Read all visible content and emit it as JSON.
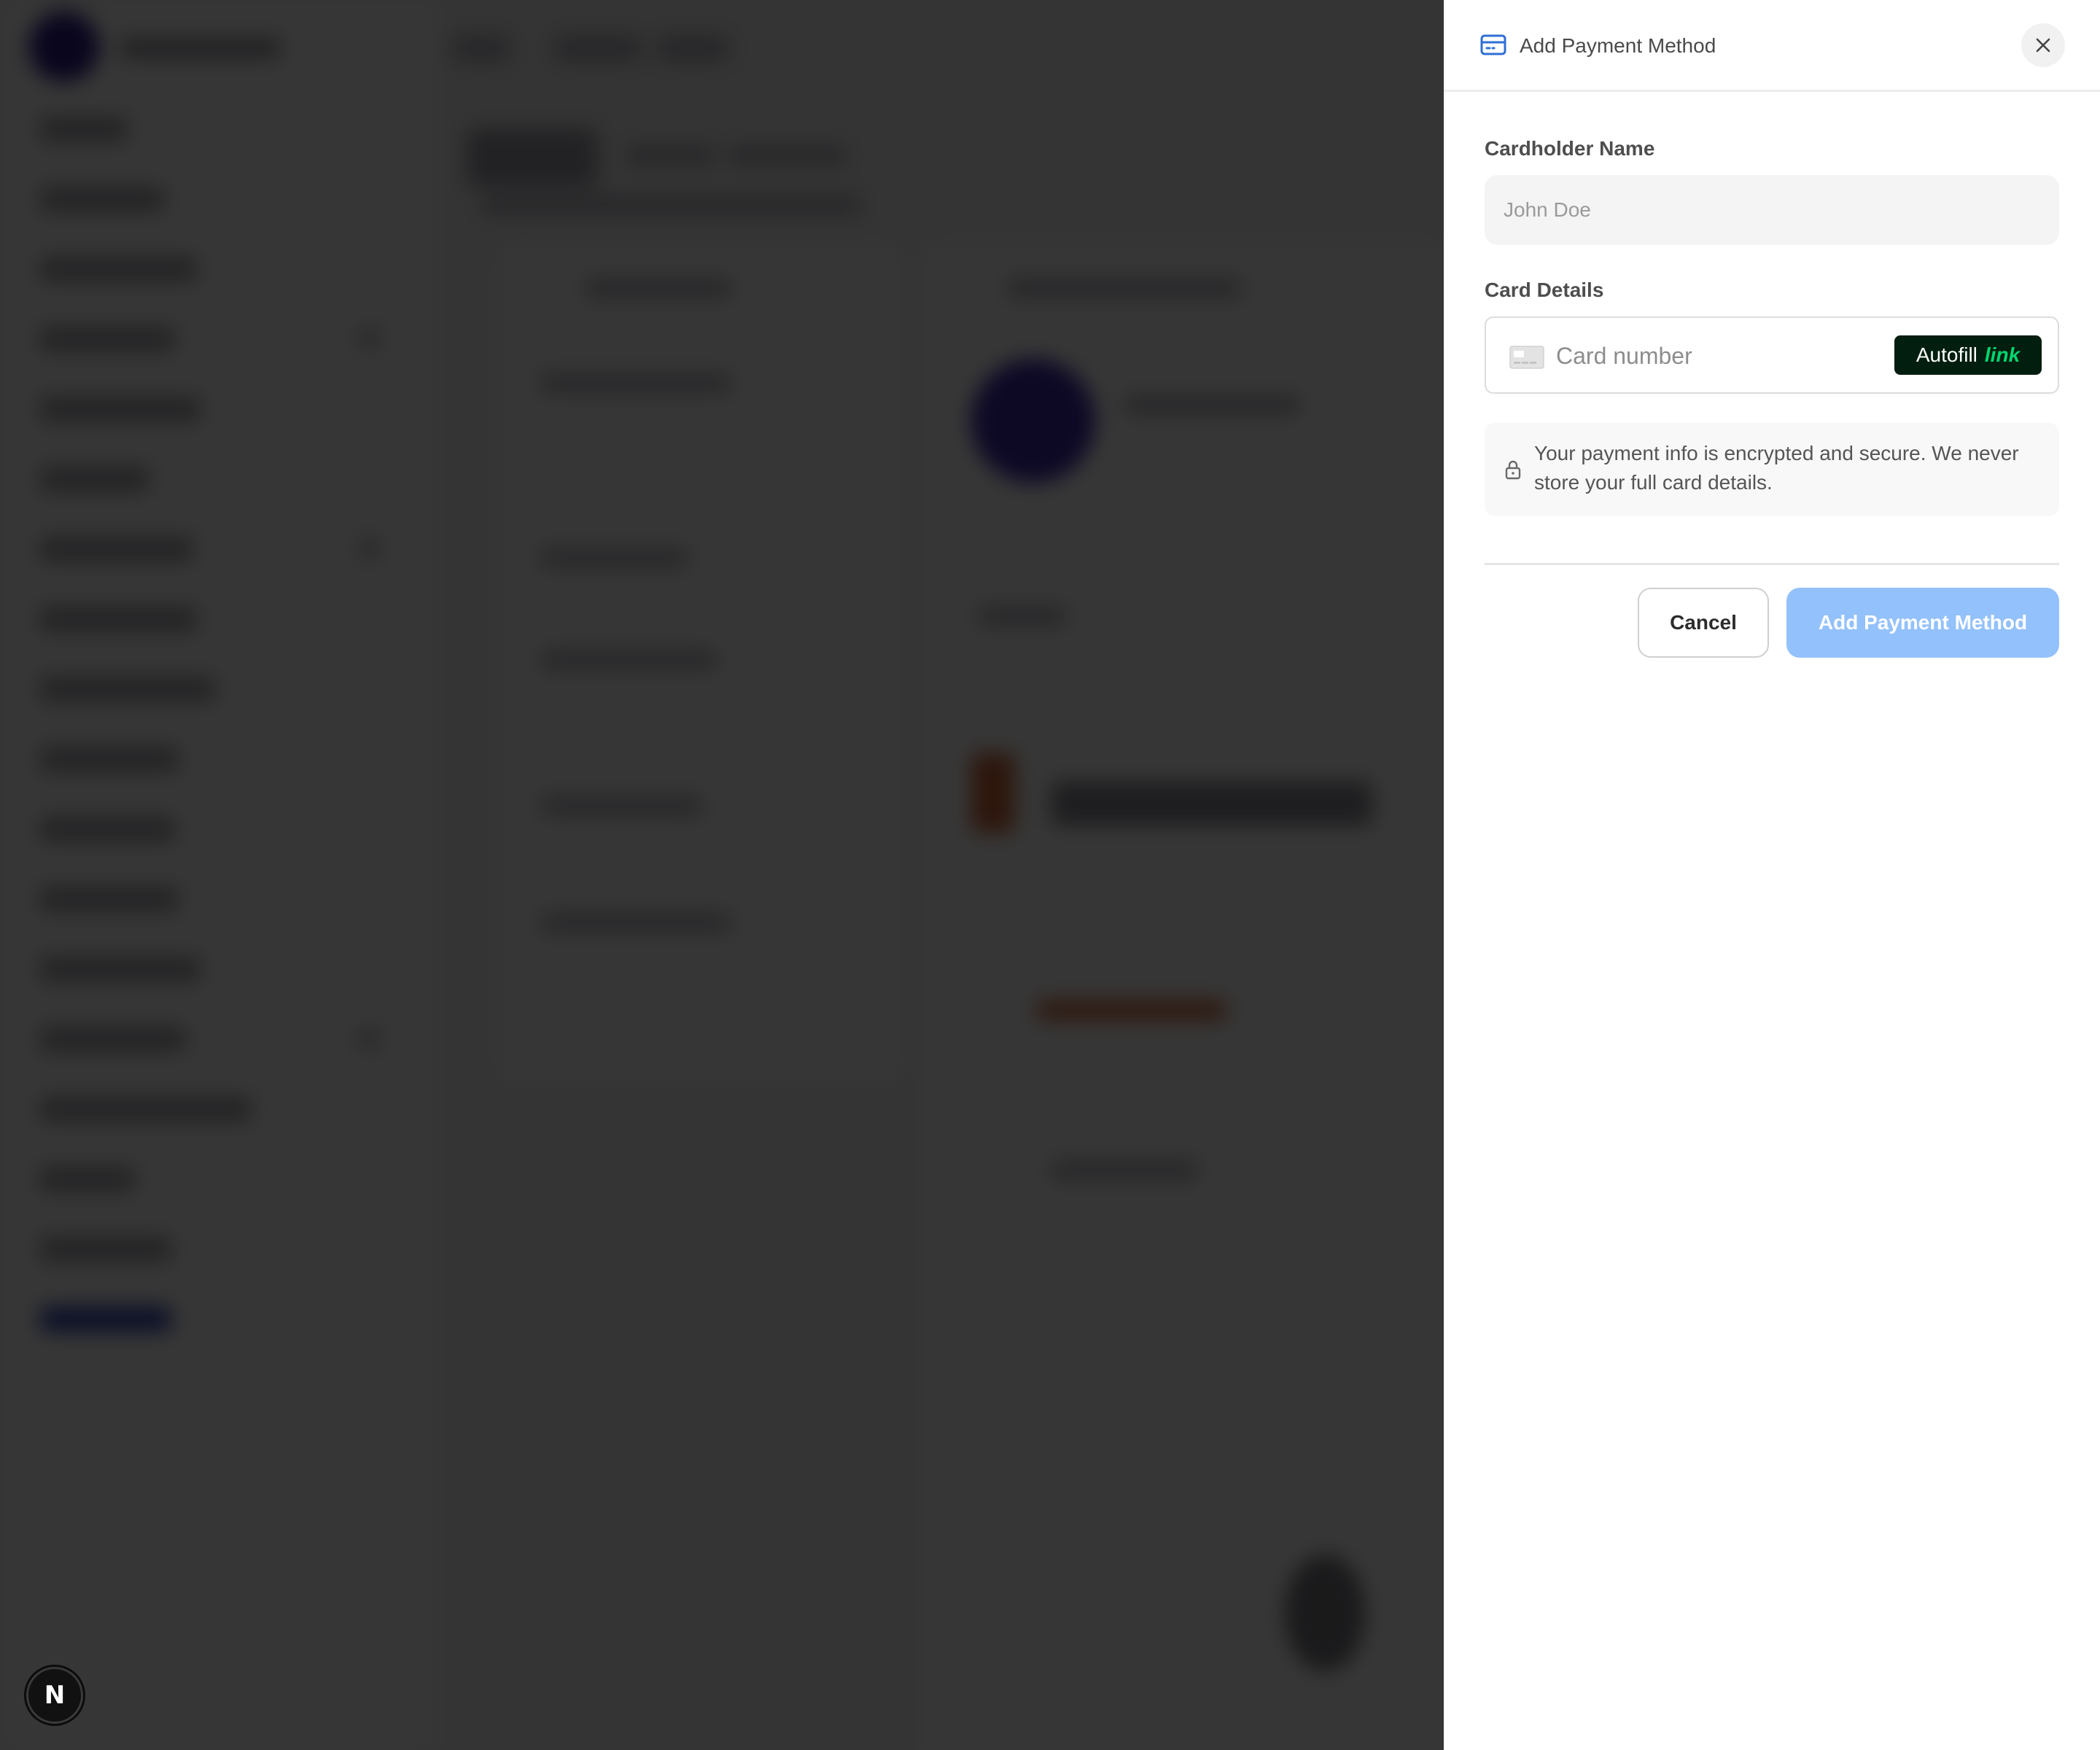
{
  "drawer": {
    "title": "Add Payment Method",
    "header_icon": "credit-card-icon",
    "close_icon": "close-icon",
    "cardholder": {
      "label": "Cardholder Name",
      "placeholder": "John Doe",
      "value": ""
    },
    "card_details": {
      "label": "Card Details",
      "card_icon": "card-placeholder-icon",
      "placeholder": "Card number",
      "value": "",
      "autofill": {
        "text": "Autofill",
        "brand": "link"
      }
    },
    "security_note": {
      "icon": "lock-icon",
      "text": "Your payment info is encrypted and secure. We never store your full card details."
    },
    "actions": {
      "cancel_label": "Cancel",
      "submit_label": "Add Payment Method",
      "submit_disabled": true
    }
  },
  "floating_badge": {
    "label": "N"
  },
  "colors": {
    "accent_icon": "#2f6fd6",
    "submit_disabled_bg": "#93c1fb",
    "autofill_bg": "#011e0f",
    "autofill_brand": "#00d66f",
    "overlay": "rgba(0,0,0,0.79)"
  }
}
